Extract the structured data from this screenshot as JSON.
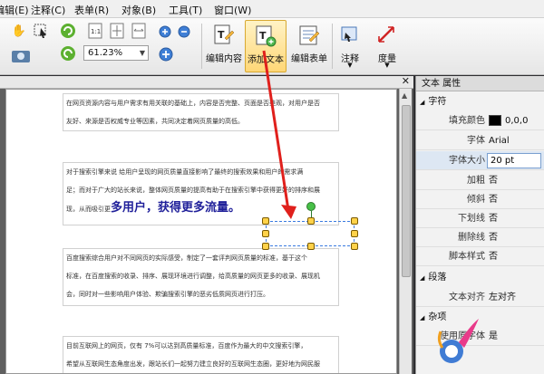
{
  "menu": {
    "items": [
      "编辑(E)",
      "注释(C)",
      "表单(R)",
      "对象(B)",
      "工具(T)",
      "窗口(W)"
    ]
  },
  "toolbar": {
    "zoom_value": "61.23%",
    "edit_content_label": "编辑内容",
    "add_text_label": "添加文本",
    "edit_form_label": "编辑表单",
    "annotate_label": "注释",
    "measure_label": "度量"
  },
  "document": {
    "para1_line1": "在网页资源内容与用户需求有用关联的基础上，内容是否完整、页面是否美观，对用户是否",
    "para1_line2": "友好、来源是否权威专业等因素，共同决定着网页质量的高低。",
    "para2_line1": "对于搜索引擎来说 给用户呈现的网页质量直接影响了最终的搜索效果和用户的需求满",
    "para2_line2": "足；而对于广大的站长来说，整体网页质量的提高有助于在搜索引擎中获得更好的排序和展",
    "para2_line3_prefix": "现，从而吸引更",
    "para2_line3_highlight": "多用户，获得更多流量。",
    "para3_line1": "百度搜索综合用户对不同网页的实际感受，制定了一套评判网页质量的标准，基于这个",
    "para3_line2": "标准，在百度搜索的收录、排序、展现环境进行调整，给高质量的网页更多的收录、展现机",
    "para3_line3": "会，同时对一些影响用户体验、欺骗搜索引擎的恶劣低质网页进行打压。",
    "para4_line1": "目前互联网上的网页，仅有 7%可以达到高质量标准，百度作为最大的中文搜索引擎，",
    "para4_line2": "希望从互联网生态角度出发，跟站长们一起努力建立良好的互联网生态圈，更好地为网民服"
  },
  "props": {
    "title": "文本 属性",
    "section_char": "字符",
    "fill_color_key": "填充颜色",
    "fill_color_val": "0,0,0",
    "font_key": "字体",
    "font_val": "Arial",
    "font_size_key": "字体大小",
    "font_size_val": "20 pt",
    "bold_key": "加粗",
    "bold_val": "否",
    "italic_key": "倾斜",
    "italic_val": "否",
    "underline_key": "下划线",
    "underline_val": "否",
    "strike_key": "删除线",
    "strike_val": "否",
    "script_key": "脚本样式",
    "script_val": "否",
    "section_para": "段落",
    "align_key": "文本对齐",
    "align_val": "左对齐",
    "section_misc": "杂项",
    "use_font_key": "使用原字体",
    "use_font_val": "是"
  },
  "colors": {
    "accent": "#ffd777",
    "arrow": "#e0201c",
    "highlight_text": "#20209a"
  }
}
